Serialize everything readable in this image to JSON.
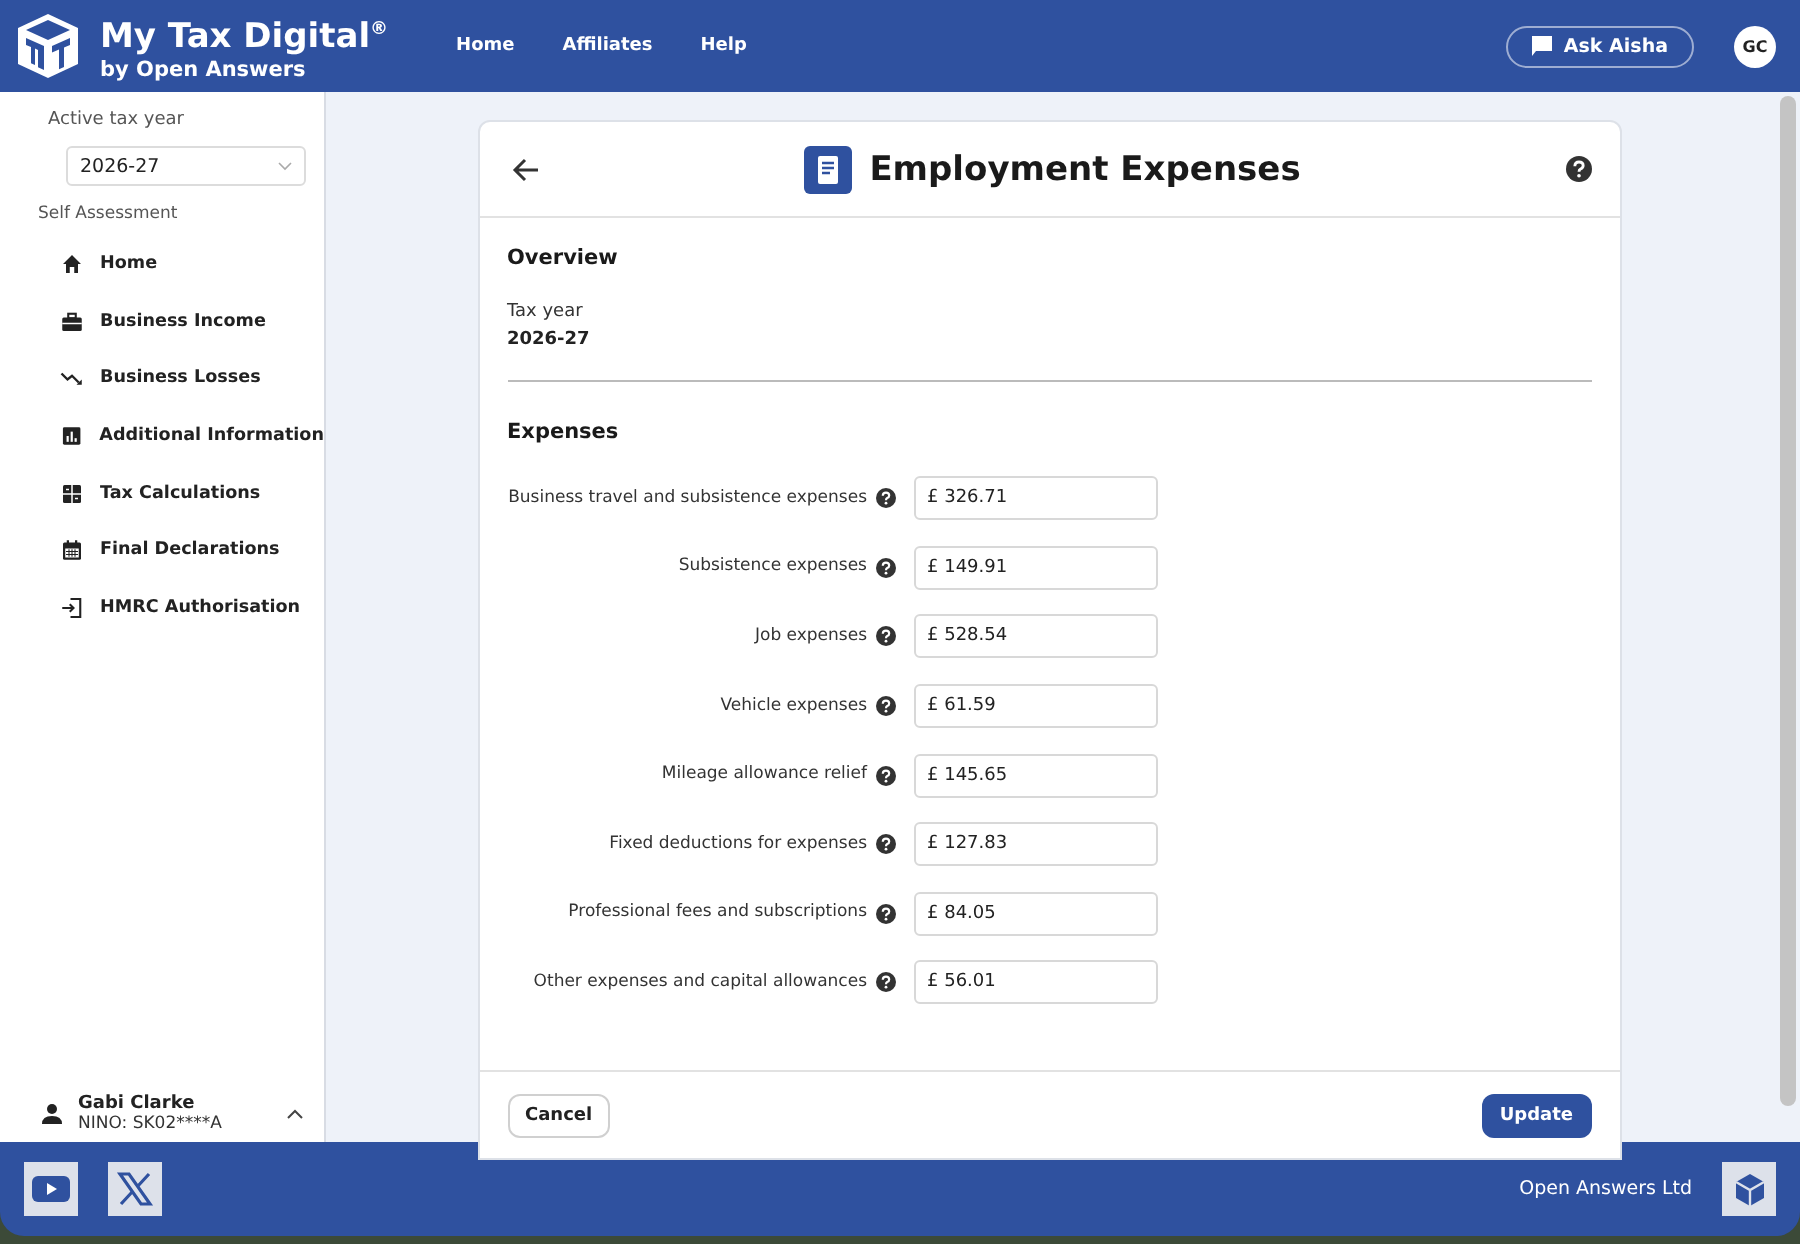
{
  "header": {
    "brand": "My Tax Digital",
    "brand_mark": "®",
    "byline": "by Open Answers",
    "nav": [
      "Home",
      "Affiliates",
      "Help"
    ],
    "assistant_button": "Ask Aisha",
    "avatar": "GC"
  },
  "sidebar": {
    "tax_year_label": "Active tax year",
    "tax_year": "2026-27",
    "section": "Self Assessment",
    "items": [
      {
        "label": "Home"
      },
      {
        "label": "Business Income"
      },
      {
        "label": "Business Losses"
      },
      {
        "label": "Additional Information"
      },
      {
        "label": "Tax Calculations"
      },
      {
        "label": "Final Declarations"
      },
      {
        "label": "HMRC Authorisation"
      }
    ],
    "user": {
      "name": "Gabi Clarke",
      "nino": "NINO: SK02****A",
      "expanded": true
    }
  },
  "card": {
    "title": "Employment Expenses",
    "overview_heading": "Overview",
    "tax_year_label": "Tax year",
    "tax_year": "2026-27",
    "expenses_heading": "Expenses",
    "expenses": [
      {
        "label": "Business travel and subsistence expenses",
        "value": "£ 326.71"
      },
      {
        "label": "Subsistence expenses",
        "value": "£ 149.91"
      },
      {
        "label": "Job expenses",
        "value": "£ 528.54"
      },
      {
        "label": "Vehicle expenses",
        "value": "£ 61.59"
      },
      {
        "label": "Mileage allowance relief",
        "value": "£ 145.65"
      },
      {
        "label": "Fixed deductions for expenses",
        "value": "£ 127.83"
      },
      {
        "label": "Professional fees and subscriptions",
        "value": "£ 84.05"
      },
      {
        "label": "Other expenses and capital allowances",
        "value": "£ 56.01"
      }
    ],
    "cancel": "Cancel",
    "update": "Update"
  },
  "footer": {
    "company": "Open Answers Ltd"
  }
}
